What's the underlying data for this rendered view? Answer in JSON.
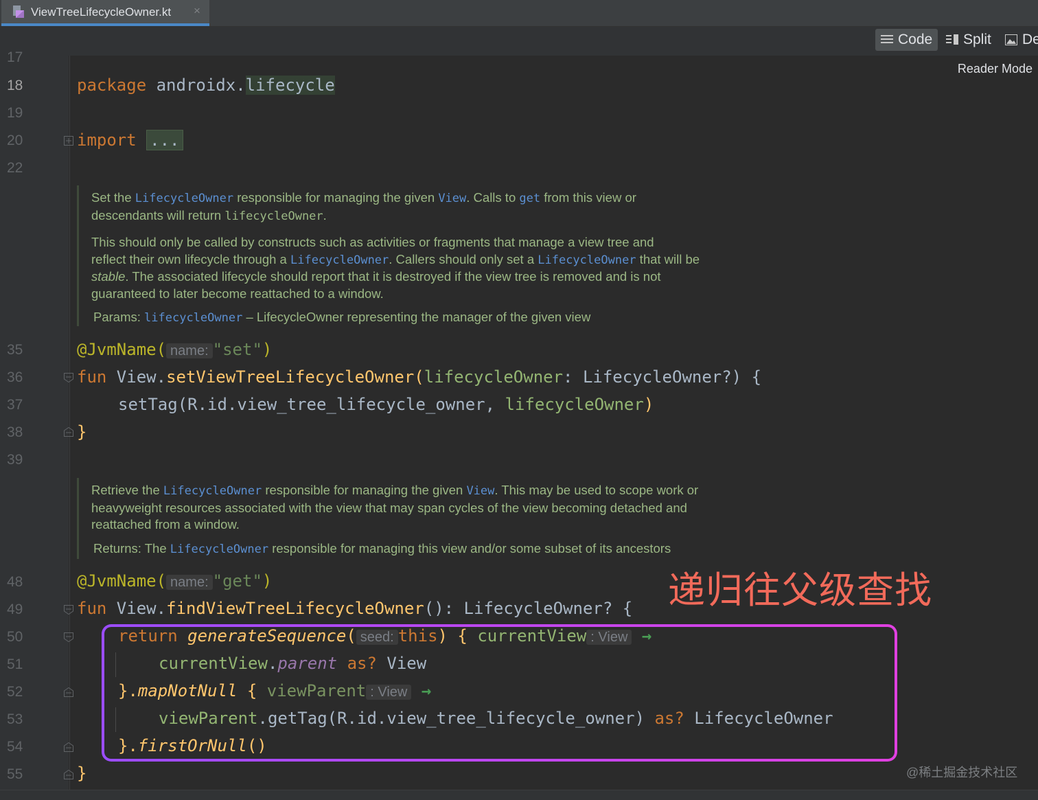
{
  "tab": {
    "filename": "ViewTreeLifecycleOwner.kt",
    "close": "×"
  },
  "modes": {
    "code": "Code",
    "split": "Split",
    "design": "De",
    "reader": "Reader Mode"
  },
  "line_numbers": [
    "17",
    "18",
    "19",
    "20",
    "22",
    "35",
    "36",
    "37",
    "38",
    "39",
    "48",
    "49",
    "50",
    "51",
    "52",
    "53",
    "54",
    "55"
  ],
  "code": {
    "l18": {
      "kw": "package",
      "pkg": "androidx.",
      "pkg2": "lifecycle"
    },
    "l20": {
      "kw": "import",
      "fold": "..."
    },
    "l35": {
      "ann": "@JvmName(",
      "hint": "name:",
      "str": "\"set\"",
      "close": ")"
    },
    "l36": {
      "kw": "fun",
      "recv": " View.",
      "fn": "setViewTreeLifecycleOwner",
      "p1": "(",
      "param": "lifecycleOwner",
      "rest": ": LifecycleOwner?) {"
    },
    "l37": {
      "call": "setTag(R.id.view_tree_lifecycle_owner, ",
      "param": "lifecycleOwner",
      "close": ")"
    },
    "l38": {
      "brace": "}"
    },
    "l48": {
      "ann": "@JvmName(",
      "hint": "name:",
      "str": "\"get\"",
      "close": ")"
    },
    "l49": {
      "kw": "fun",
      "recv": " View.",
      "fn": "findViewTreeLifecycleOwner",
      "rest": "(): LifecycleOwner? {"
    },
    "l50": {
      "kw": "return",
      "fn": "generateSequence",
      "p": "(",
      "hint": "seed:",
      "this": "this",
      "p2": ") { ",
      "param": "currentView",
      "hint2": ": View",
      "arrow": "→"
    },
    "l51": {
      "param": "currentView",
      "dot": ".",
      "prop": "parent",
      "as": "as?",
      "type": " View"
    },
    "l52": {
      "pre": "}.",
      "fn": "mapNotNull",
      "brace": " { ",
      "param": "viewParent",
      "hint": ": View",
      "arrow": "→"
    },
    "l53": {
      "param": "viewParent",
      "call": ".getTag(R.id.view_tree_lifecycle_owner) ",
      "as": "as?",
      "type": " LifecycleOwner"
    },
    "l54": {
      "pre": "}.",
      "fn": "firstOrNull",
      "post": "()"
    },
    "l55": {
      "brace": "}"
    }
  },
  "doc1": {
    "p1a": "Set the ",
    "p1link1": "LifecycleOwner",
    "p1b": " responsible for managing the given ",
    "p1link2": "View",
    "p1c": ". Calls to ",
    "p1link3": "get",
    "p1d": " from this view or",
    "p1e": "descendants will return ",
    "p1code": "lifecycleOwner",
    "p1f": ".",
    "p2a": "This should only be called by constructs such as activities or fragments that manage a view tree and",
    "p2b": "reflect their own lifecycle through a ",
    "p2link1": "LifecycleOwner",
    "p2c": ". Callers should only set a ",
    "p2link2": "LifecycleOwner",
    "p2d": " that will be",
    "p2e_ital": "stable",
    "p2e": ". The associated lifecycle should report that it is destroyed if the view tree is removed and is not",
    "p2f": "guaranteed to later become reattached to a window.",
    "params_label": "Params: ",
    "params_link": "lifecycleOwner",
    "params_text": " – LifecycleOwner representing the manager of the given view"
  },
  "doc2": {
    "p1a": "Retrieve the ",
    "p1link1": "LifecycleOwner",
    "p1b": " responsible for managing the given ",
    "p1link2": "View",
    "p1c": ". This may be used to scope work or",
    "p1d": "heavyweight resources associated with the view that may span cycles of the view becoming detached and",
    "p1e": "reattached from a window.",
    "returns_label": "Returns: ",
    "returns_a": "The ",
    "returns_link": "LifecycleOwner",
    "returns_b": " responsible for managing this view and/or some subset of its ancestors"
  },
  "annotation": "递归往父级查找",
  "watermark": "@稀土掘金技术社区",
  "colors": {
    "keyword": "#cc7832",
    "function": "#ffc66d",
    "param": "#93b572",
    "string": "#6a8759",
    "annotation": "#bbb529",
    "doc": "#9bb784",
    "highlight_box": "#c040f0",
    "annotation_text": "#f26a5a"
  }
}
